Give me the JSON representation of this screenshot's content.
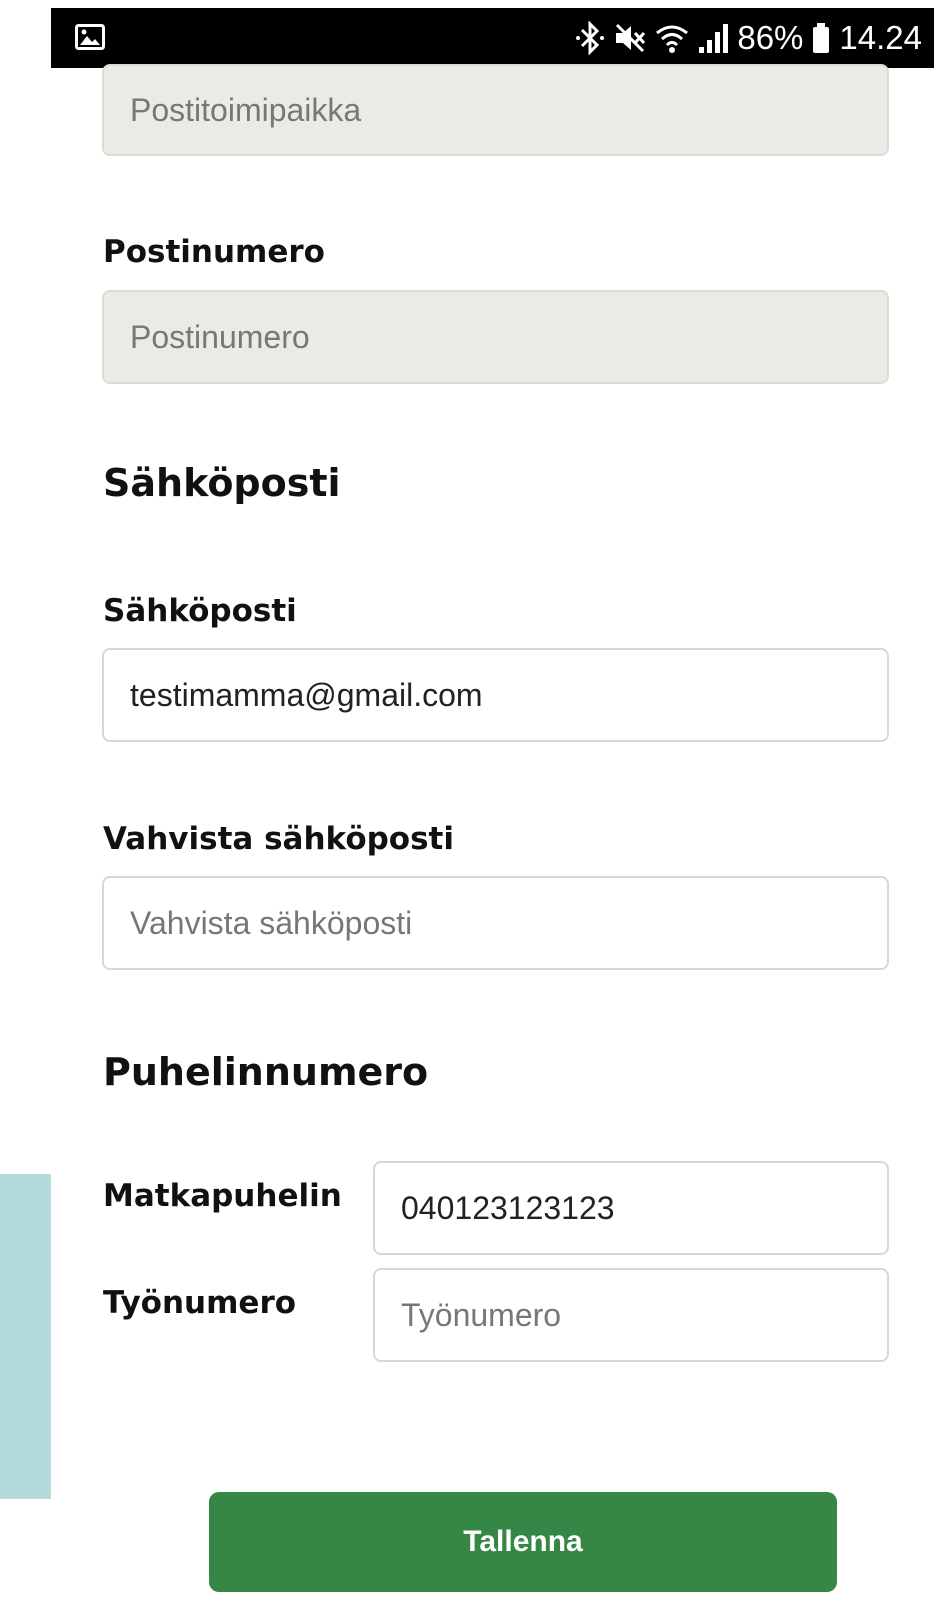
{
  "status_bar": {
    "battery_percent": "86%",
    "time": "14.24",
    "icons": [
      "image-icon",
      "bluetooth-icon",
      "mute-icon",
      "wifi-icon",
      "signal-icon",
      "battery-icon"
    ]
  },
  "address": {
    "city_placeholder": "Postitoimipaikka",
    "postal_label": "Postinumero",
    "postal_placeholder": "Postinumero"
  },
  "email": {
    "heading": "Sähköposti",
    "email_label": "Sähköposti",
    "email_value": "testimamma@gmail.com",
    "confirm_label": "Vahvista sähköposti",
    "confirm_placeholder": "Vahvista sähköposti"
  },
  "phone": {
    "heading": "Puhelinnumero",
    "mobile_label": "Matkapuhelin",
    "mobile_value": "040123123123",
    "work_label": "Työnumero",
    "work_placeholder": "Työnumero"
  },
  "actions": {
    "save_label": "Tallenna"
  },
  "colors": {
    "primary_button": "#368745",
    "disabled_field": "#ebebe6",
    "accent_strip": "#b5dadb"
  }
}
